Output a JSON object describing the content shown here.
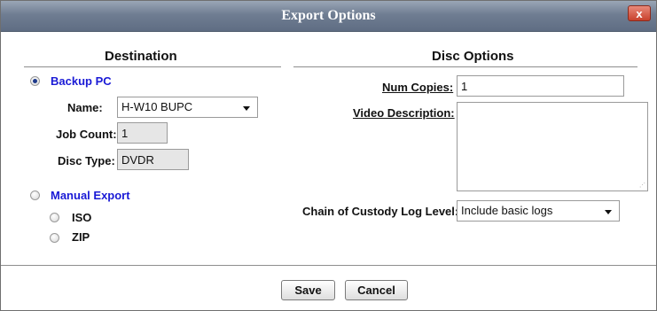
{
  "window": {
    "title": "Export Options",
    "close_label": "x"
  },
  "destination": {
    "heading": "Destination",
    "backup_pc": {
      "label": "Backup PC",
      "selected": true,
      "name_label": "Name:",
      "name_value": "H-W10 BUPC",
      "job_count_label": "Job Count:",
      "job_count_value": "1",
      "disc_type_label": "Disc Type:",
      "disc_type_value": "DVDR"
    },
    "manual_export": {
      "label": "Manual Export",
      "selected": false,
      "options": [
        {
          "label": "ISO"
        },
        {
          "label": "ZIP"
        }
      ]
    }
  },
  "disc_options": {
    "heading": "Disc Options",
    "num_copies_label": "Num Copies:",
    "num_copies_value": "1",
    "video_description_label": "Video Description:",
    "video_description_value": "",
    "custody_log_label": "Chain of Custody Log Level:",
    "custody_log_value": "Include basic logs"
  },
  "footer": {
    "save_label": "Save",
    "cancel_label": "Cancel"
  }
}
